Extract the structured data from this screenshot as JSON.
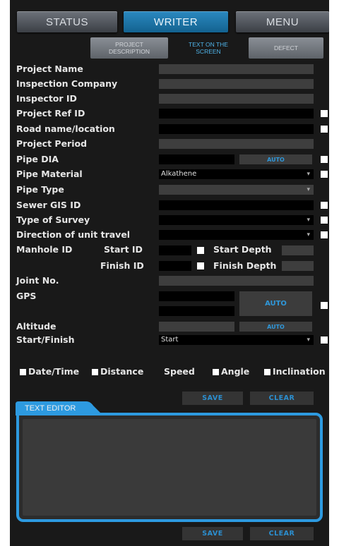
{
  "tabs": [
    {
      "label": "STATUS"
    },
    {
      "label": "WRITER"
    },
    {
      "label": "MENU"
    }
  ],
  "subtabs": [
    {
      "label": "PROJECT\nDESCRIPTION"
    },
    {
      "label": "TEXT ON THE\nSCREEN"
    },
    {
      "label": "DEFECT"
    }
  ],
  "fields": {
    "project_name": "Project Name",
    "inspection_company": "Inspection Company",
    "inspector_id": "Inspector ID",
    "project_ref_id": "Project Ref ID",
    "road_name": "Road name/location",
    "project_period": "Project Period",
    "pipe_dia": "Pipe DIA",
    "pipe_material": "Pipe Material",
    "pipe_material_value": "Alkathene",
    "pipe_type": "Pipe Type",
    "sewer_gis_id": "Sewer GIS ID",
    "type_of_survey": "Type of Survey",
    "direction": "Direction of unit travel",
    "manhole_id": "Manhole ID",
    "start_id": "Start ID",
    "start_depth": "Start Depth",
    "finish_id": "Finish ID",
    "finish_depth": "Finish Depth",
    "joint_no": "Joint No.",
    "gps": "GPS",
    "altitude": "Altitude",
    "start_finish": "Start/Finish",
    "start_finish_value": "Start"
  },
  "auto_label": "AUTO",
  "options": {
    "datetime": "Date/Time",
    "distance": "Distance",
    "speed": "Speed",
    "angle": "Angle",
    "inclination": "Inclination"
  },
  "buttons": {
    "save": "SAVE",
    "clear": "CLEAR"
  },
  "editor": {
    "tab_label": "TEXT EDITOR"
  },
  "colors": {
    "accent": "#2d9ae0",
    "background": "#191919"
  }
}
